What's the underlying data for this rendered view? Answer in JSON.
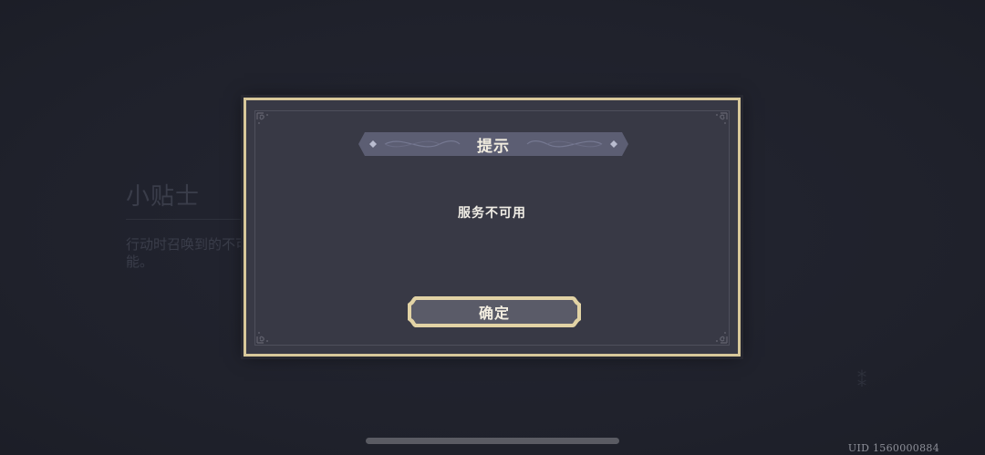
{
  "background": {
    "tip_title": "小贴士",
    "tip_body": "行动时召唤到的不可能。"
  },
  "dialog": {
    "title": "提示",
    "message": "服务不可用",
    "confirm_label": "确定"
  },
  "footer": {
    "uid": "UID 1560000884"
  },
  "colors": {
    "background": "#20222c",
    "dialog_bg": "#383945",
    "gold_border": "#d8c89a",
    "banner_bg": "#5c5e73",
    "button_bg": "#5a5b68",
    "text_primary": "#f2ede0"
  },
  "icons": {
    "corner": "ornament-corner-icon",
    "banner_diamond": "diamond-icon"
  }
}
